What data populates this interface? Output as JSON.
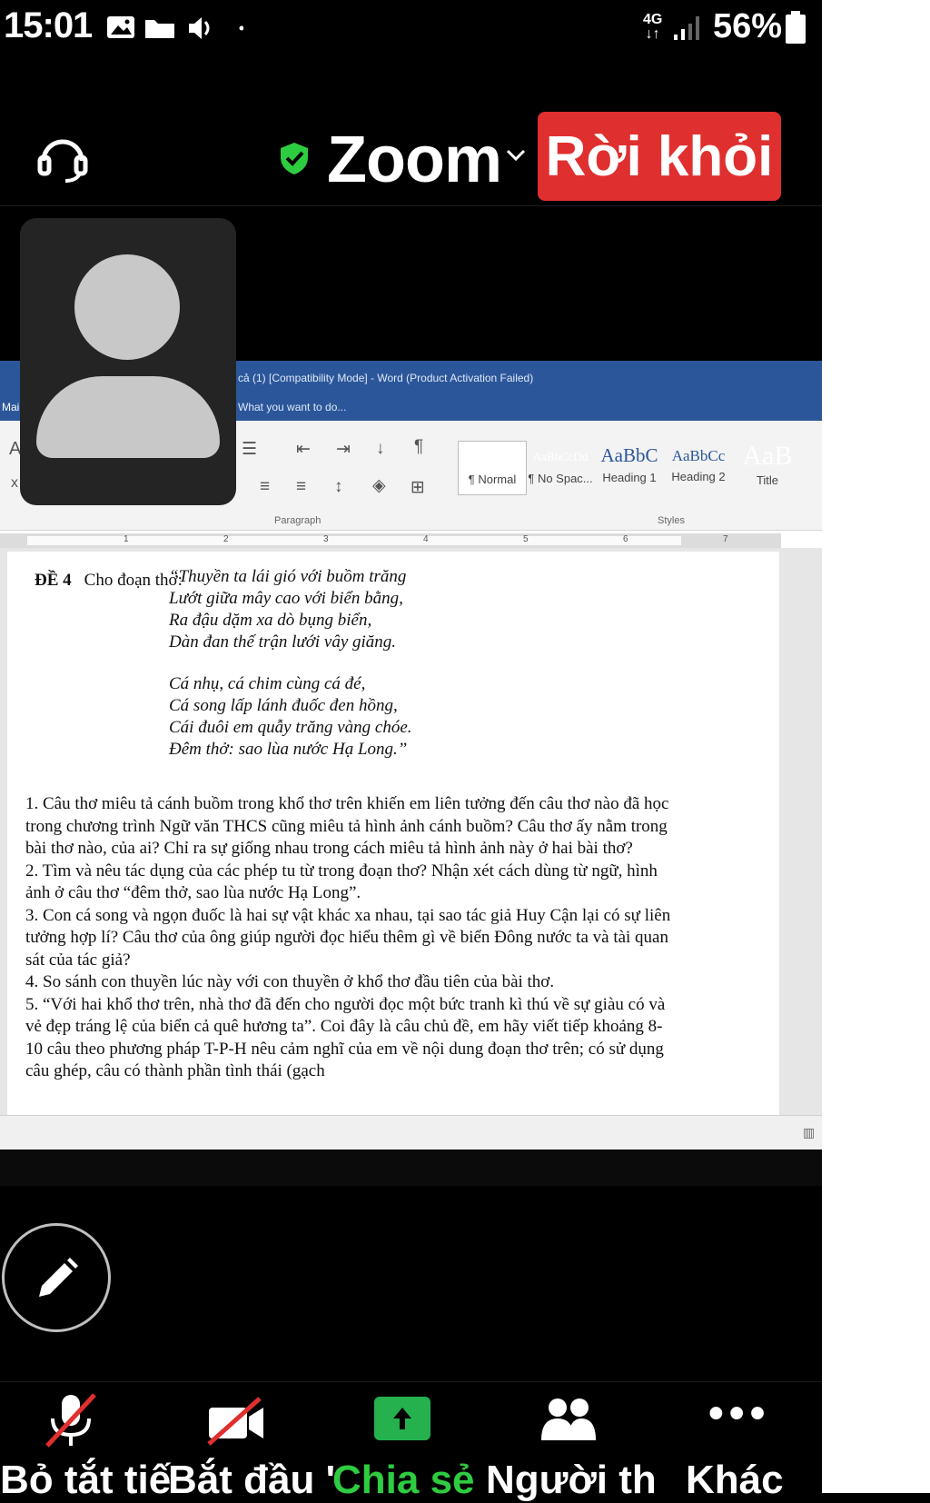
{
  "status_bar": {
    "time": "15:01",
    "network": "4G",
    "battery": "56%"
  },
  "header": {
    "title": "Zoom",
    "leave_label": "Rời khỏi",
    "shield_color": "#2ecc40",
    "leave_color": "#e02f2f"
  },
  "word": {
    "title_text": "cả (1) [Compatibility Mode] - Word (Product Activation Failed)",
    "tell_me": "What you want to do...",
    "tab": "Mai",
    "styles": [
      {
        "sample": "AaBbCcDd",
        "name": "¶ Normal"
      },
      {
        "sample": "AaBbCcDd",
        "name": "¶ No Spac..."
      },
      {
        "sample": "AaBbC",
        "name": "Heading 1"
      },
      {
        "sample": "AaBbCc",
        "name": "Heading 2"
      },
      {
        "sample": "AaB",
        "name": "Title"
      }
    ],
    "groups": {
      "paragraph": "Paragraph",
      "styles": "Styles"
    },
    "ruler_numbers": [
      "1",
      "2",
      "3",
      "4",
      "5",
      "6",
      "7"
    ]
  },
  "document": {
    "heading_number": "ĐỀ 4",
    "heading_text": "Cho đoạn thơ:",
    "poem": [
      "“Thuyền ta lái gió với buồm trăng",
      "Lướt giữa mây cao với biển bằng,",
      "Ra đậu dặm xa dò bụng biển,",
      "Dàn đan thế trận lưới vây giăng.",
      "",
      "Cá nhụ, cá chim cùng cá đé,",
      "Cá song lấp lánh đuốc đen hồng,",
      "Cái đuôi em quẫy trăng vàng chóe.",
      "Đêm thở: sao lùa nước Hạ Long.”"
    ],
    "questions": [
      "1. Câu thơ miêu tả cánh buồm trong khổ thơ trên khiến em liên tưởng đến câu thơ nào đã học trong chương trình Ngữ văn THCS cũng miêu tả hình ảnh cánh buồm? Câu thơ ấy nằm trong bài thơ nào, của ai? Chỉ ra sự giống nhau trong cách miêu tả hình ảnh này ở hai bài thơ?",
      "2. Tìm và nêu tác dụng của các phép tu từ trong đoạn thơ? Nhận xét cách dùng từ ngữ, hình ảnh ở câu thơ “đêm thở, sao lùa nước Hạ Long”.",
      "3. Con cá song và ngọn đuốc là hai sự vật khác xa nhau, tại sao tác giả Huy Cận lại có sự liên tưởng hợp lí? Câu thơ của ông giúp người đọc hiểu thêm gì về biển Đông nước ta và tài quan sát của tác giả?",
      "4. So sánh con thuyền lúc này với con thuyền ở khổ thơ đầu tiên của bài thơ.",
      "5. “Với hai khổ thơ trên, nhà thơ đã đến cho người đọc một bức tranh kì thú về sự giàu có và vẻ đẹp tráng lệ của biển cả quê hương ta”. Coi đây là câu chủ đề, em hãy viết tiếp khoảng 8-10 câu theo phương pháp T-P-H nêu cảm nghĩ của em về nội dung đoạn thơ trên; có sử dụng câu ghép, câu có thành phần tình thái (gạch"
    ]
  },
  "toolbar": {
    "mute_label": "Bỏ tắt tiế",
    "video_label": "Bắt đầu '",
    "share_label": "Chia sẻ",
    "participants_label": "Người th",
    "more_label": "Khác",
    "share_color": "#24b14e"
  }
}
